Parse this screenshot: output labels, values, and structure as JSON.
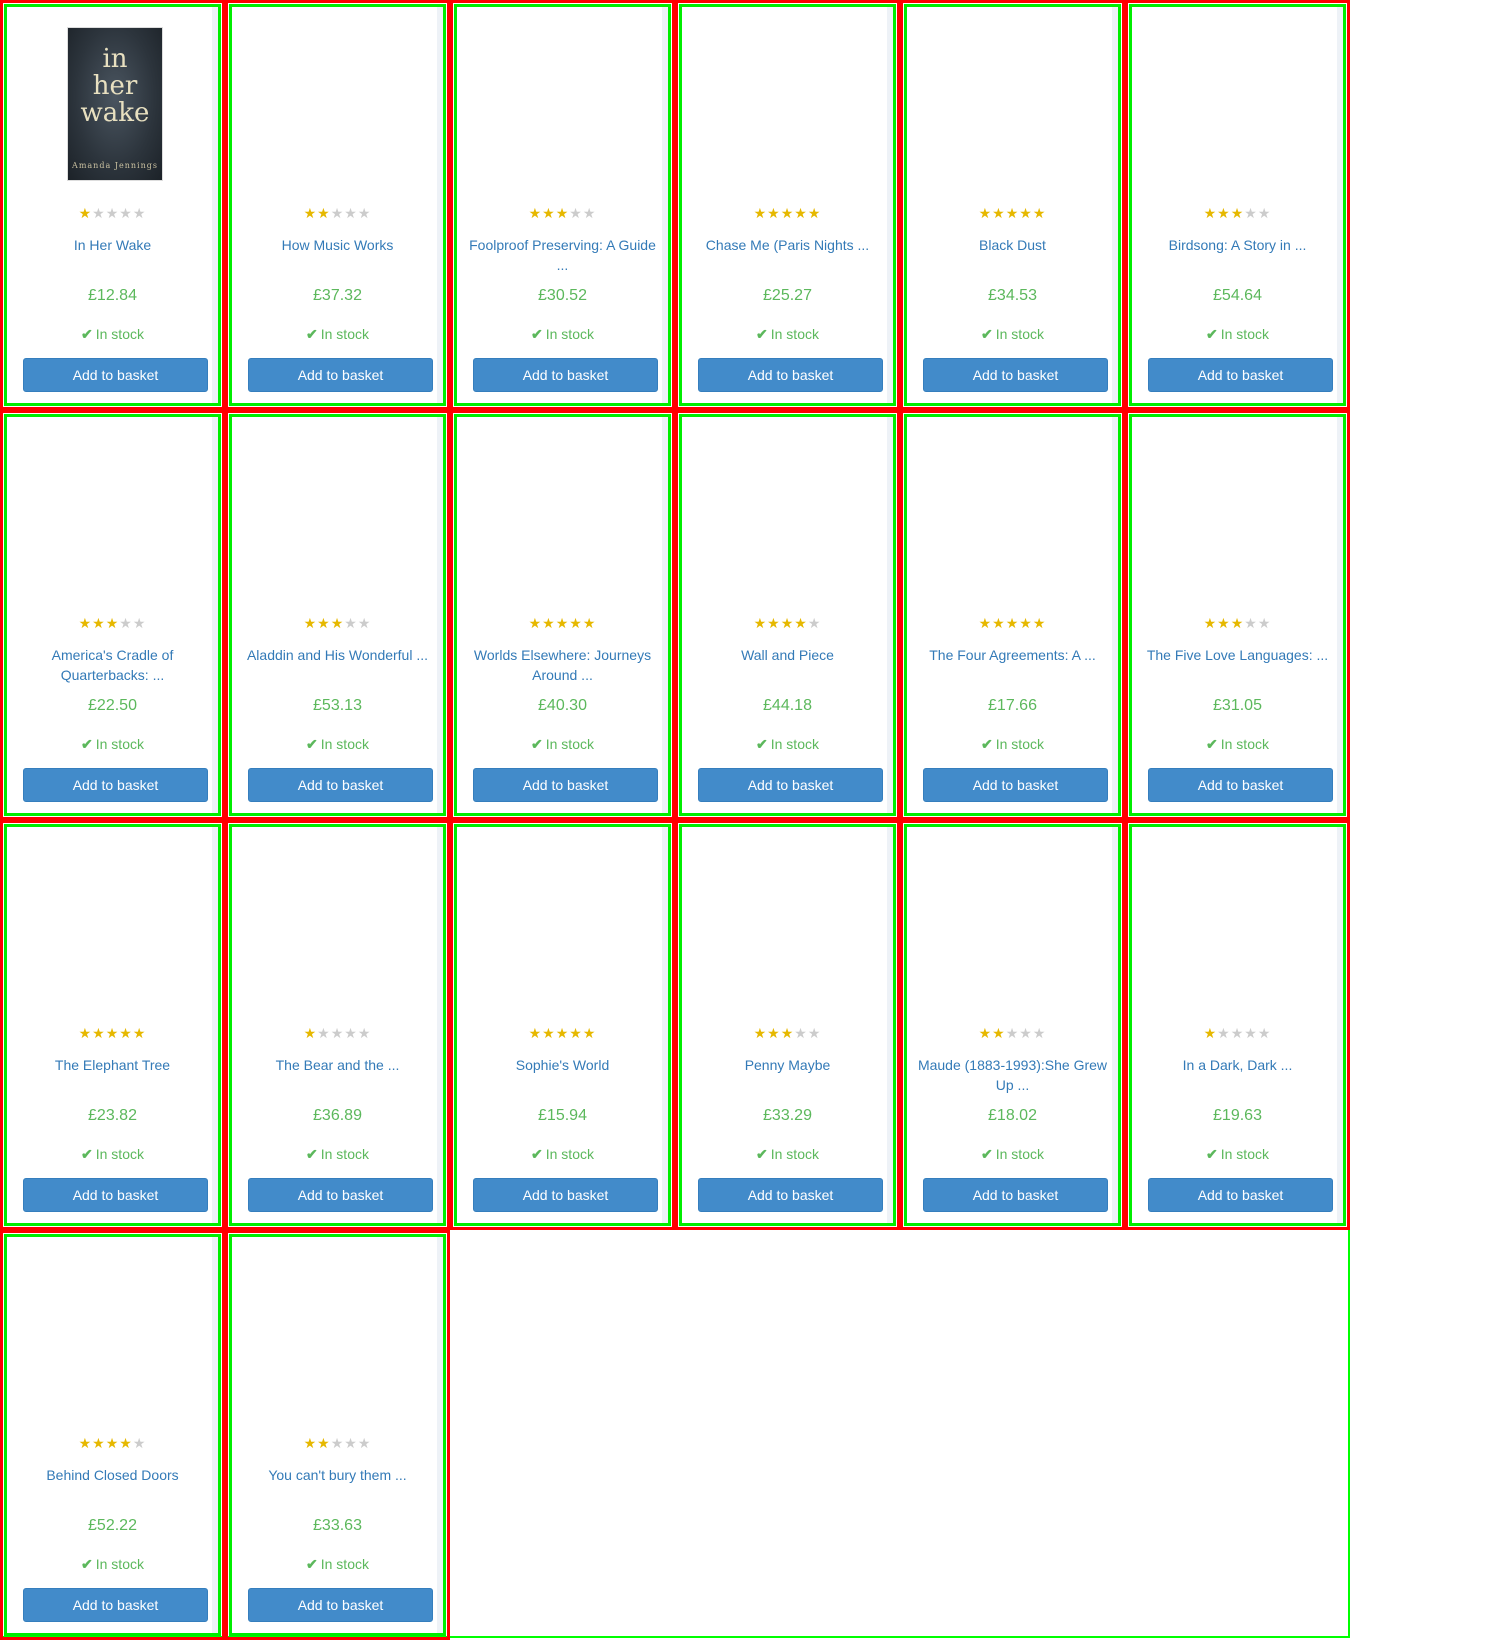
{
  "stock_label": "In stock",
  "check_glyph": "✔",
  "button_label": "Add to basket",
  "products": [
    {
      "title": "In Her Wake",
      "rating": 1,
      "price": "£12.84",
      "cover": {
        "title_lines": [
          "in",
          "her",
          "wake"
        ],
        "author": "Amanda Jennings"
      }
    },
    {
      "title": "How Music Works",
      "rating": 2,
      "price": "£37.32"
    },
    {
      "title": "Foolproof Preserving: A Guide ...",
      "rating": 3,
      "price": "£30.52"
    },
    {
      "title": "Chase Me (Paris Nights ...",
      "rating": 5,
      "price": "£25.27"
    },
    {
      "title": "Black Dust",
      "rating": 5,
      "price": "£34.53"
    },
    {
      "title": "Birdsong: A Story in ...",
      "rating": 3,
      "price": "£54.64"
    },
    {
      "title": "America's Cradle of Quarterbacks: ...",
      "rating": 3,
      "price": "£22.50"
    },
    {
      "title": "Aladdin and His Wonderful ...",
      "rating": 3,
      "price": "£53.13"
    },
    {
      "title": "Worlds Elsewhere: Journeys Around ...",
      "rating": 5,
      "price": "£40.30"
    },
    {
      "title": "Wall and Piece",
      "rating": 4,
      "price": "£44.18"
    },
    {
      "title": "The Four Agreements: A ...",
      "rating": 5,
      "price": "£17.66"
    },
    {
      "title": "The Five Love Languages: ...",
      "rating": 3,
      "price": "£31.05"
    },
    {
      "title": "The Elephant Tree",
      "rating": 5,
      "price": "£23.82"
    },
    {
      "title": "The Bear and the ...",
      "rating": 1,
      "price": "£36.89"
    },
    {
      "title": "Sophie's World",
      "rating": 5,
      "price": "£15.94"
    },
    {
      "title": "Penny Maybe",
      "rating": 3,
      "price": "£33.29"
    },
    {
      "title": "Maude (1883-1993):She Grew Up ...",
      "rating": 2,
      "price": "£18.02"
    },
    {
      "title": "In a Dark, Dark ...",
      "rating": 1,
      "price": "£19.63"
    },
    {
      "title": "Behind Closed Doors",
      "rating": 4,
      "price": "£52.22"
    },
    {
      "title": "You can't bury them ...",
      "rating": 2,
      "price": "£33.63"
    }
  ]
}
